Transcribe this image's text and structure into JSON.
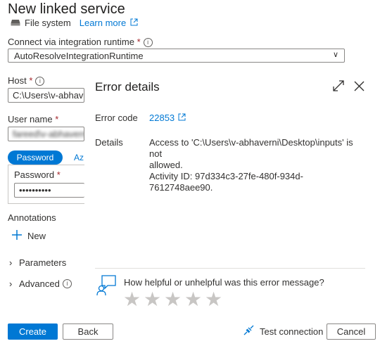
{
  "title": "New linked service",
  "subtitle": {
    "type": "File system",
    "learn_more": "Learn more"
  },
  "runtime": {
    "label": "Connect via integration runtime",
    "value": "AutoResolveIntegrationRuntime"
  },
  "host": {
    "label": "Host",
    "value": "C:\\Users\\v-abhaverni"
  },
  "user": {
    "label": "User name",
    "value": "fareed\\v-abhaverni"
  },
  "auth_tabs": {
    "active": "Password",
    "inactive": "Az"
  },
  "password": {
    "label": "Password",
    "value": "••••••••••"
  },
  "annotations": {
    "label": "Annotations",
    "new": "New"
  },
  "sections": {
    "parameters": "Parameters",
    "advanced": "Advanced"
  },
  "error": {
    "title": "Error details",
    "code_label": "Error code",
    "code_value": "22853",
    "details_label": "Details",
    "details_line1": "Access to 'C:\\Users\\v-abhaverni\\Desktop\\inputs' is not",
    "details_line2": "allowed.",
    "activity": "Activity ID: 97d334c3-27fe-480f-934d-7612748aee90.",
    "feedback_question": "How helpful or unhelpful was this error message?",
    "rating": 0,
    "rating_max": 5
  },
  "footer": {
    "create": "Create",
    "back": "Back",
    "test": "Test connection",
    "cancel": "Cancel"
  },
  "colors": {
    "accent": "#0078d4",
    "required": "#a4262c"
  }
}
